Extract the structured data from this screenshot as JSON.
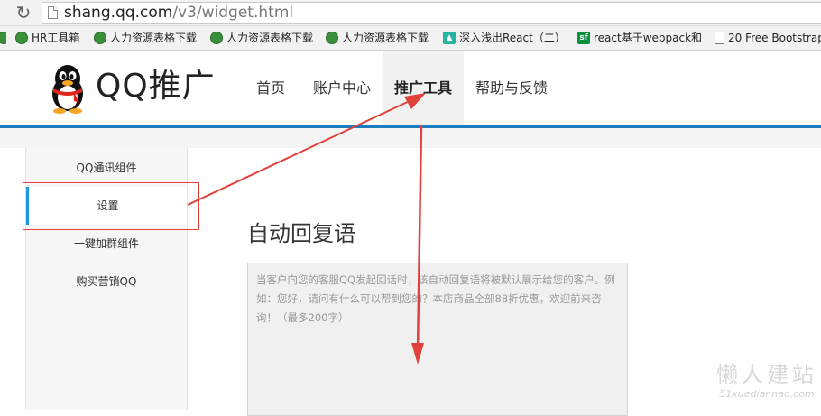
{
  "browser": {
    "url_host": "shang.qq.com",
    "url_path": "/v3/widget.html"
  },
  "bookmarks": [
    {
      "label": "HR工具箱",
      "icon": "globe-icon"
    },
    {
      "label": "人力资源表格下载",
      "icon": "globe-icon"
    },
    {
      "label": "人力资源表格下载",
      "icon": "globe-icon"
    },
    {
      "label": "人力资源表格下载",
      "icon": "globe-icon"
    },
    {
      "label": "深入浅出React（二）",
      "icon": "teal-icon"
    },
    {
      "label": "react基于webpack和",
      "icon": "sf-icon"
    },
    {
      "label": "20 Free Bootstrap",
      "icon": "document-icon"
    }
  ],
  "header": {
    "brand": "QQ推广",
    "nav": [
      {
        "label": "首页"
      },
      {
        "label": "账户中心"
      },
      {
        "label": "推广工具",
        "active": true
      },
      {
        "label": "帮助与反馈"
      }
    ],
    "accent_color": "#1d7bbf"
  },
  "sidebar": {
    "items": [
      {
        "label": "QQ通讯组件"
      },
      {
        "label": "设置",
        "active": true
      },
      {
        "label": "一键加群组件"
      },
      {
        "label": "购买营销QQ"
      }
    ],
    "active_color": "#1a9be0"
  },
  "main": {
    "title": "自动回复语",
    "textarea_placeholder": "当客户向您的客服QQ发起回话时，该自动回复语将被默认展示给您的客户。例如：您好，请问有什么可以帮到您的？本店商品全部88折优惠，欢迎前来咨询！（最多200字）"
  },
  "annotation": {
    "color": "#e0413b"
  },
  "watermark": {
    "title": "懒人建站",
    "subtitle": "51xuediannao.com"
  }
}
